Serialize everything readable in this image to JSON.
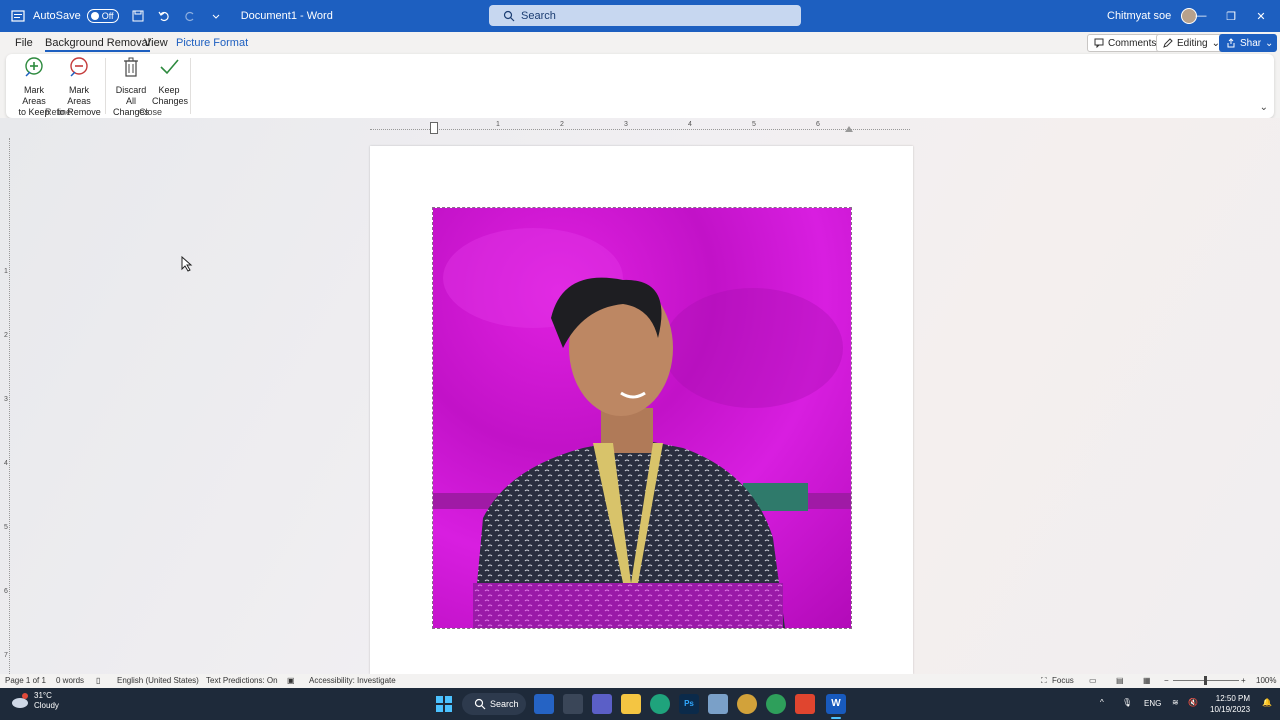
{
  "titlebar": {
    "autosave_label": "AutoSave",
    "autosave_state": "Off",
    "document_title": "Document1 - Word",
    "search_placeholder": "Search",
    "user_name": "Chitmyat soe"
  },
  "menu": {
    "tabs": [
      {
        "label": "File"
      },
      {
        "label": "Background Removal"
      },
      {
        "label": "View"
      },
      {
        "label": "Picture Format"
      }
    ],
    "comments_label": "Comments",
    "editing_label": "Editing",
    "share_label": "Share"
  },
  "ribbon": {
    "groups": [
      {
        "label": "Refine",
        "commands": [
          {
            "line1": "Mark Areas",
            "line2": "to Keep"
          },
          {
            "line1": "Mark Areas",
            "line2": "to Remove"
          }
        ]
      },
      {
        "label": "Close",
        "commands": [
          {
            "line1": "Discard All",
            "line2": "Changes"
          },
          {
            "line1": "Keep",
            "line2": "Changes"
          }
        ]
      }
    ]
  },
  "ruler": {
    "h_numbers": [
      "1",
      "2",
      "3",
      "4",
      "5",
      "6"
    ],
    "v_numbers": [
      "1",
      "2",
      "3",
      "4",
      "5",
      "6",
      "7"
    ]
  },
  "statusbar": {
    "page": "Page 1 of 1",
    "words": "0 words",
    "language": "English (United States)",
    "predictions": "Text Predictions: On",
    "accessibility": "Accessibility: Investigate",
    "focus": "Focus",
    "zoom": "100%"
  },
  "taskbar": {
    "weather_temp": "31°C",
    "weather_desc": "Cloudy",
    "search_label": "Search",
    "language": "ENG",
    "time": "12:50 PM",
    "date": "10/19/2023"
  },
  "colors": {
    "accent": "#1d5fc0",
    "removal_magenta": "#d21ad8"
  }
}
